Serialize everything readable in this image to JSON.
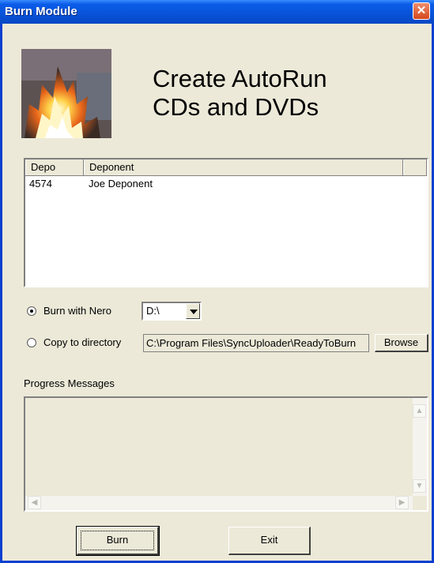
{
  "window": {
    "title": "Burn Module",
    "close_glyph": "✕"
  },
  "header": {
    "logo": "fire-icon",
    "headline_line1": "Create AutoRun",
    "headline_line2": "CDs and DVDs"
  },
  "list": {
    "columns": [
      "Depo",
      "Deponent",
      ""
    ],
    "rows": [
      {
        "depo": "4574",
        "deponent": "Joe Deponent"
      }
    ]
  },
  "options": {
    "burn_label": "Burn with Nero",
    "burn_selected": true,
    "drive_value": "D:\\",
    "copy_label": "Copy to directory",
    "copy_path": "C:\\Program Files\\SyncUploader\\ReadyToBurn",
    "browse_label": "Browse"
  },
  "progress": {
    "label": "Progress Messages",
    "text": ""
  },
  "buttons": {
    "burn_label": "Burn",
    "exit_label": "Exit"
  },
  "colors": {
    "titlebar": "#0853d8",
    "face": "#ece9d8",
    "close": "#d5471c"
  }
}
